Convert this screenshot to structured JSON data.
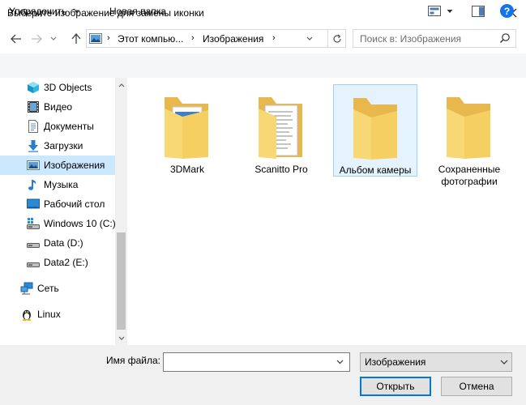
{
  "window": {
    "title": "Выберите изображение для замены иконки"
  },
  "address": {
    "crumbs": [
      "Этот компью...",
      "Изображения"
    ]
  },
  "search": {
    "placeholder": "Поиск в: Изображения"
  },
  "toolbar": {
    "organize_label": "Упорядочить",
    "new_folder_label": "Новая папка",
    "help_label": "?"
  },
  "sidebar": {
    "items": [
      {
        "label": "3D Objects",
        "icon": "3d-objects-icon"
      },
      {
        "label": "Видео",
        "icon": "video-icon"
      },
      {
        "label": "Документы",
        "icon": "documents-icon"
      },
      {
        "label": "Загрузки",
        "icon": "downloads-icon"
      },
      {
        "label": "Изображения",
        "icon": "pictures-icon",
        "selected": true
      },
      {
        "label": "Музыка",
        "icon": "music-icon"
      },
      {
        "label": "Рабочий стол",
        "icon": "desktop-icon"
      },
      {
        "label": "Windows 10 (C:)",
        "icon": "system-drive-icon"
      },
      {
        "label": "Data (D:)",
        "icon": "drive-icon"
      },
      {
        "label": "Data2 (E:)",
        "icon": "drive-icon"
      },
      {
        "label": "Сеть",
        "icon": "network-icon"
      },
      {
        "label": "Linux",
        "icon": "linux-icon"
      }
    ]
  },
  "folders": [
    {
      "label": "3DMark"
    },
    {
      "label": "Scanitto Pro"
    },
    {
      "label": "Альбом камеры"
    },
    {
      "label": "Сохраненные фотографии"
    }
  ],
  "bottom": {
    "filename_label": "Имя файла:",
    "filename_value": "",
    "filter_value": "Изображения",
    "open_label": "Открыть",
    "cancel_label": "Отмена"
  },
  "colors": {
    "selection": "#cce8ff",
    "hover_border": "#99d1ff",
    "folder_yellow": "#f8d775",
    "accent": "#0078d7"
  }
}
